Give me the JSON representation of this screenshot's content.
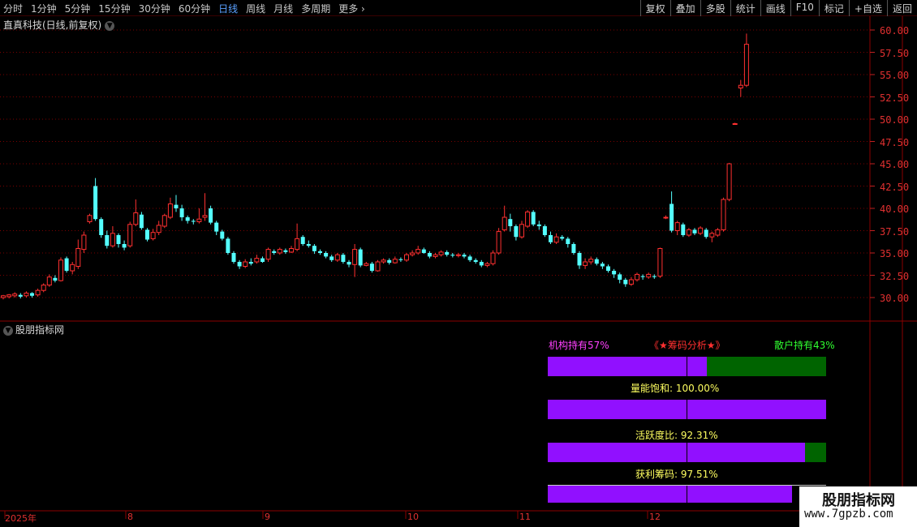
{
  "toolbar": {
    "periods": [
      "分时",
      "1分钟",
      "5分钟",
      "15分钟",
      "30分钟",
      "60分钟",
      "日线",
      "周线",
      "月线",
      "多周期",
      "更多 ›"
    ],
    "active_period": "日线",
    "right_tools": [
      "复权",
      "叠加",
      "多股",
      "统计",
      "画线",
      "F10",
      "标记",
      "+自选",
      "返回"
    ]
  },
  "stock_title": "直真科技(日线,前复权)",
  "indicator_title": "股朋指标网",
  "y_axis_labels": [
    "60.00",
    "57.50",
    "55.00",
    "52.50",
    "50.00",
    "47.50",
    "45.00",
    "42.50",
    "40.00",
    "37.50",
    "35.00",
    "32.50",
    "30.00"
  ],
  "x_axis_labels": [
    "2025年",
    "8",
    "9",
    "10",
    "11",
    "12"
  ],
  "chip_panel": {
    "institution_label": "机构持有57%",
    "title": "《★筹码分析★》",
    "retail_label": "散户持有43%",
    "volume_label": "量能饱和: 100.00%",
    "activity_label": "活跃度比: 92.31%",
    "profit_label": "获利筹码: 97.51%",
    "institution_pct": 57,
    "volume_pct": 100,
    "activity_pct": 92.31,
    "profit_pct": 97.51
  },
  "watermark": {
    "line1": "股朋指标网",
    "line2": "www.7gpzb.com"
  },
  "colors": {
    "up": "#ff3030",
    "down": "#54ffff",
    "bar_purple": "#9110ff",
    "bar_green": "#006400",
    "grid": "#8b0000"
  }
}
